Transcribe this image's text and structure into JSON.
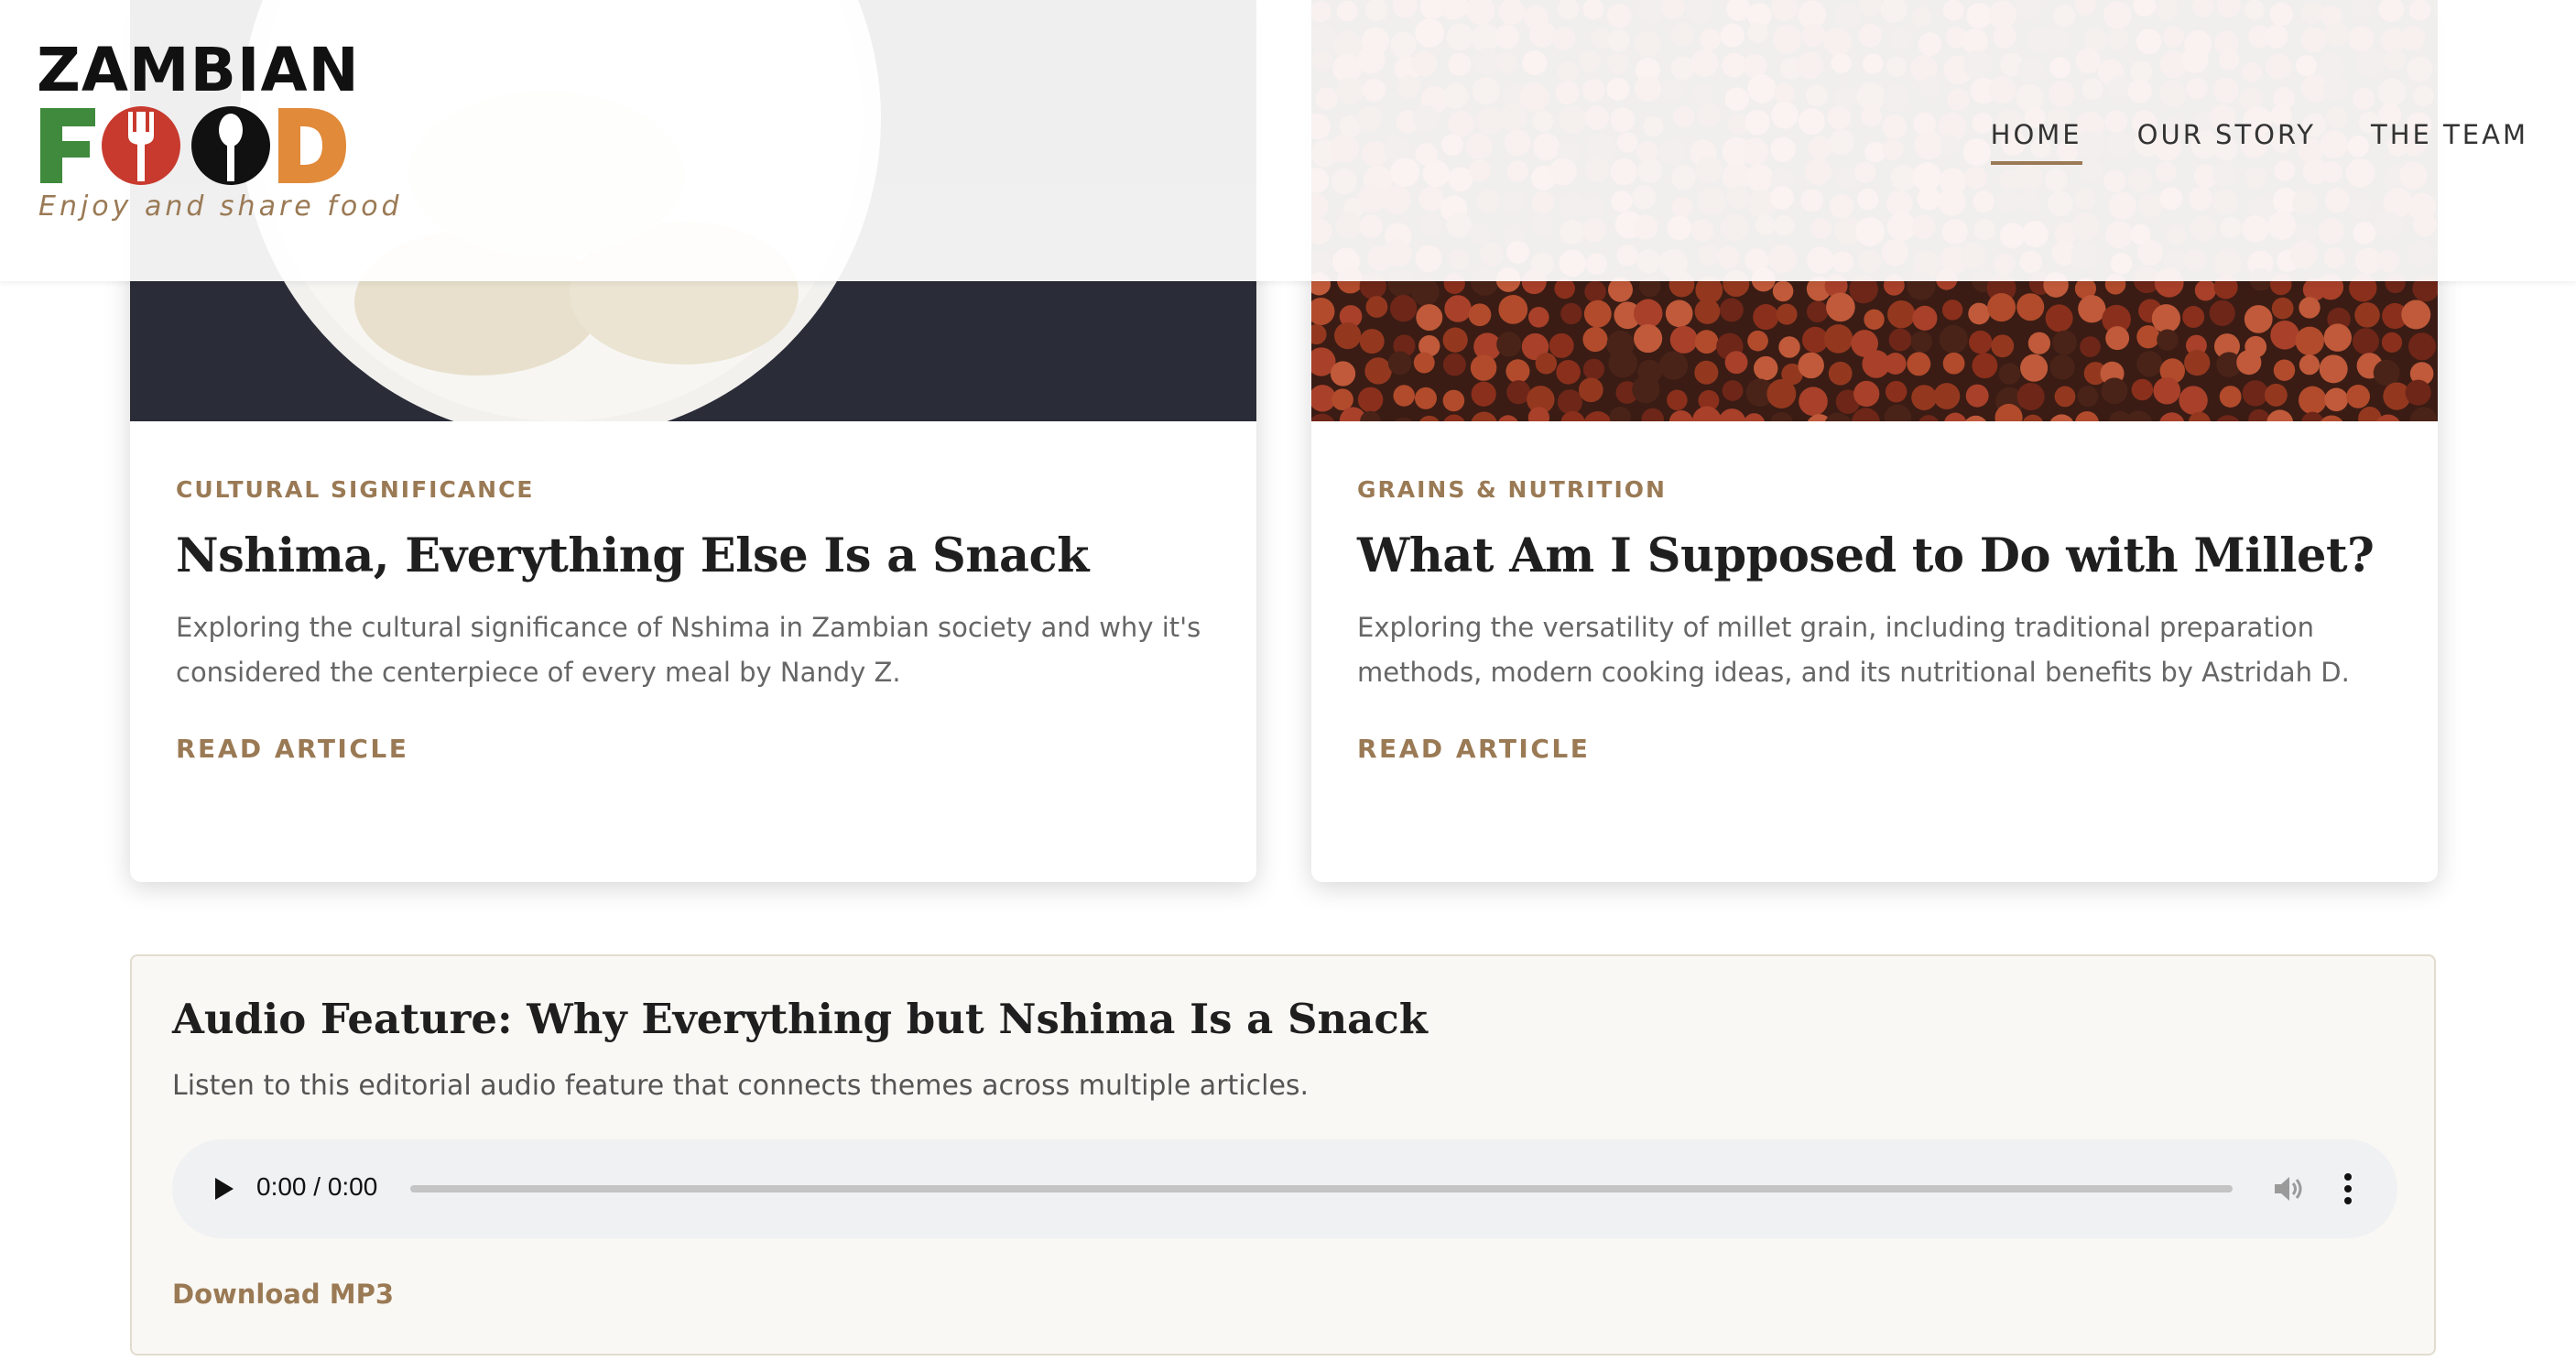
{
  "brand": {
    "name_top": "ZAMBIAN",
    "name_bottom": "FOOD",
    "tagline": "Enjoy and share food",
    "colors": {
      "green": "#3f8a3c",
      "red": "#c83a2e",
      "orange": "#e08a3a",
      "dark": "#111111"
    }
  },
  "nav": {
    "items": [
      {
        "label": "HOME",
        "active": true
      },
      {
        "label": "OUR STORY",
        "active": false
      },
      {
        "label": "THE TEAM",
        "active": false
      }
    ]
  },
  "articles": [
    {
      "image_icon": "nshima-plate-image",
      "category": "CULTURAL SIGNIFICANCE",
      "title": "Nshima, Everything Else Is a Snack",
      "excerpt": "Exploring the cultural significance of Nshima in Zambian society and why it's considered the centerpiece of every meal by Nandy Z.",
      "cta": "READ ARTICLE"
    },
    {
      "image_icon": "millet-grains-image",
      "category": "GRAINS & NUTRITION",
      "title": "What Am I Supposed to Do with Millet?",
      "excerpt": "Exploring the versatility of millet grain, including traditional preparation methods, modern cooking ideas, and its nutritional benefits by Astridah D.",
      "cta": "READ ARTICLE"
    }
  ],
  "audio": {
    "title": "Audio Feature: Why Everything but Nshima Is a Snack",
    "description": "Listen to this editorial audio feature that connects themes across multiple articles.",
    "time": "0:00 / 0:00",
    "download_label": "Download MP3"
  },
  "theme": {
    "accent": "#9a7a55",
    "text_dark": "#1f1f1f",
    "text_muted": "#666666"
  }
}
